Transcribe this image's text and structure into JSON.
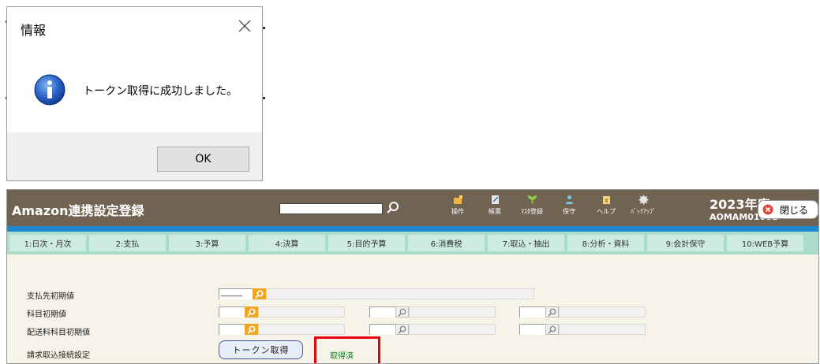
{
  "dialog": {
    "title": "情報",
    "message": "トークン取得に成功しました。",
    "ok_label": "OK"
  },
  "app": {
    "title": "Amazon連携設定登録",
    "search_value": "",
    "toolbar": [
      "操作",
      "帳票",
      "ﾏｽﾀ登録",
      "保守",
      "ヘルプ",
      "ﾊﾞｯｸｱｯﾌﾟ"
    ],
    "year": "2023年度",
    "user_id": "AOMAM01001",
    "close_label": "閉じる",
    "tabs": [
      "1:日次・月次",
      "2:支払",
      "3:予算",
      "4:決算",
      "5:目的予算",
      "6:消費税",
      "7:取込・抽出",
      "8:分析・資料",
      "9:会計保守",
      "10:WEB予算"
    ],
    "fields": {
      "payee_label": "支払先初期値",
      "payee_code": "______",
      "subject_label": "科目初期値",
      "shipping_label": "配送料科目初期値",
      "billing_label": "請求取込接続設定"
    },
    "token_button": "トークン取得",
    "status_text": "取得済"
  },
  "colors": {
    "header": "#706352",
    "blue_band": "#1d89cc",
    "tab_bar": "#a9dccb",
    "tab": "#cdebdf",
    "magnifier": "#f5a41e",
    "highlight": "#e60012",
    "status_text": "#0a7a1a"
  }
}
